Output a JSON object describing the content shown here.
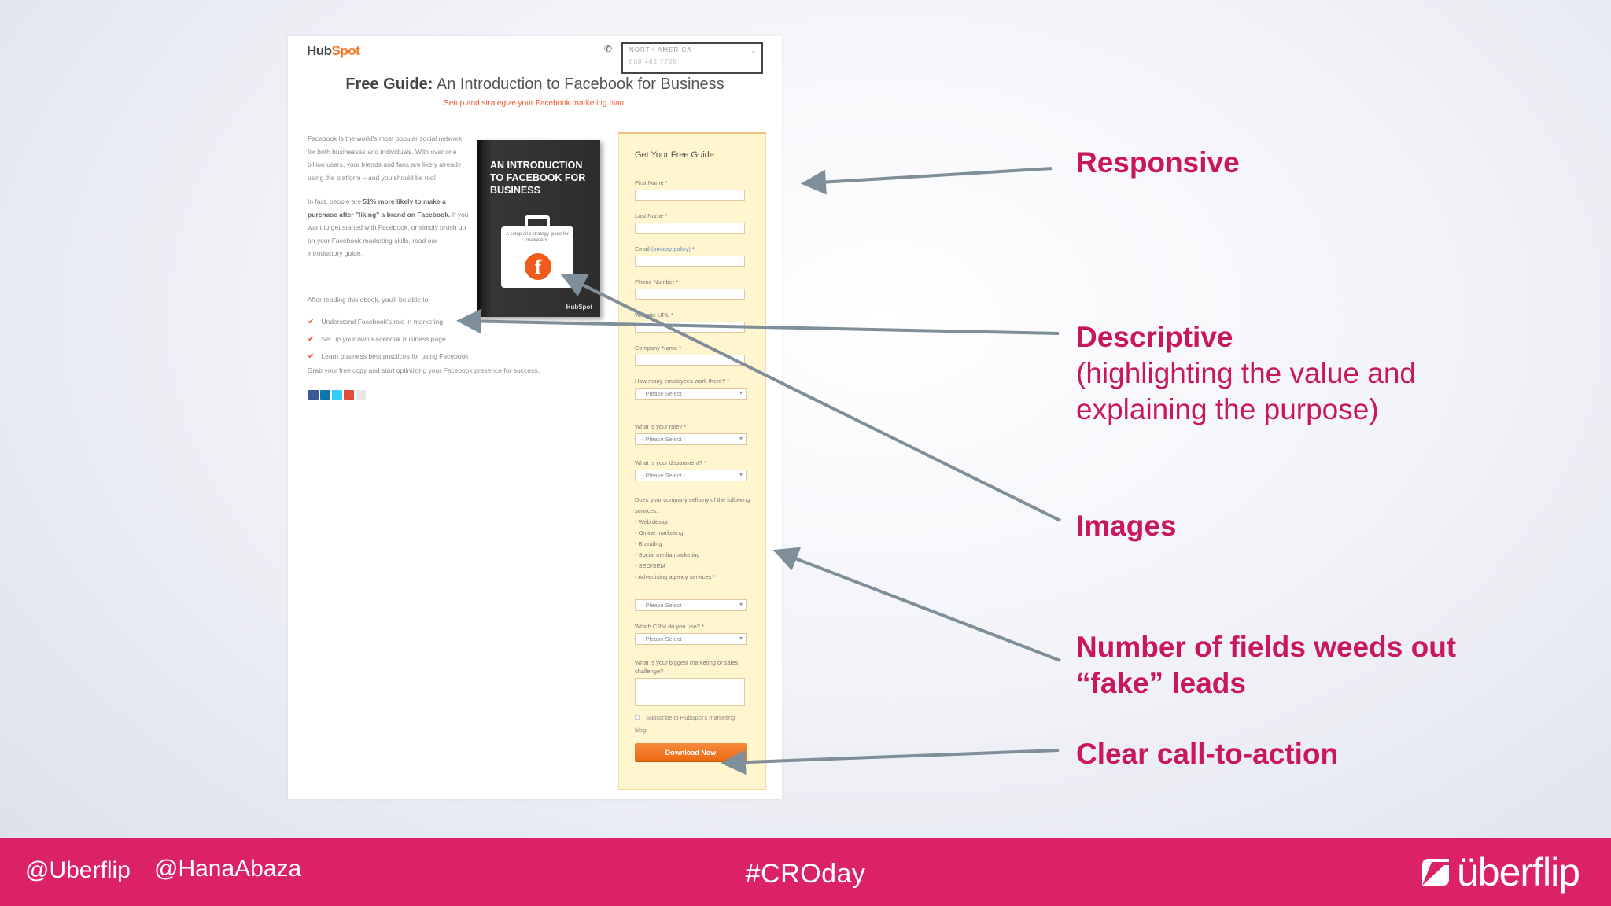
{
  "landing_page": {
    "logo": "HubSpot",
    "region": "NORTH AMERICA",
    "phone": "888 482 7768",
    "title_bold": "Free Guide:",
    "title_rest": "An Introduction to Facebook for Business",
    "subtitle": "Setup and strategize your Facebook marketing plan.",
    "intro_p1": "Facebook is the world's most popular social network for both businesses and individuals. With over one billion users, your friends and fans are likely already using the platform – and you should be too!",
    "intro_p2_start": "In fact, people are",
    "intro_p2_bold": "51% more likely to make a purchase after \"liking\" a brand on Facebook.",
    "intro_p2_end": "If you want to get started with Facebook, or simply brush up on your Facebook marketing skills, read our introductory guide.",
    "after_text": "After reading this ebook, you'll be able to:",
    "bullets": [
      "Understand Facebook's role in marketing",
      "Set up your own Facebook business page",
      "Learn business best practices for using Facebook"
    ],
    "grab_text": "Grab your free copy and start optimizing your Facebook presence for success.",
    "book": {
      "title": "AN INTRODUCTION TO FACEBOOK FOR BUSINESS",
      "case_text": "A setup and strategy guide for marketers.",
      "logo": "HubSpot"
    },
    "form": {
      "heading": "Get Your Free Guide:",
      "first_name": "First Name *",
      "last_name": "Last Name *",
      "email": "Email",
      "privacy": "(privacy policy)",
      "email_req": " *",
      "phone": "Phone Number *",
      "website": "Website URL *",
      "company": "Company Name *",
      "employees": "How many employees work there? *",
      "role": "What is your role? *",
      "department": "What is your department? *",
      "services_q": "Does your company sell any of the following services:",
      "services": [
        "- Web design",
        "- Online marketing",
        "- Branding",
        "- Social media marketing",
        "- SEO/SEM",
        "- Advertising agency services *"
      ],
      "crm": "Which CRM do you use? *",
      "challenge": "What is your biggest marketing or sales challenge?",
      "select_placeholder": "- Please Select -",
      "subscribe": "Subscribe to HubSpot's marketing blog",
      "cta": "Download Now"
    }
  },
  "annotations": {
    "responsive": "Responsive",
    "descriptive": "Descriptive",
    "descriptive_sub": "(highlighting the value and explaining the purpose)",
    "images": "Images",
    "fields": "Number of fields weeds out “fake” leads",
    "cta": "Clear call-to-action"
  },
  "footer": {
    "handle1": "@Uberflip",
    "handle2": "@HanaAbaza",
    "hashtag": "#CROday",
    "brand": "überflip"
  },
  "colors": {
    "accent": "#dc2266",
    "annotation": "#c8175d",
    "arrow": "#7f8f99",
    "cta": "#ee6a14"
  }
}
